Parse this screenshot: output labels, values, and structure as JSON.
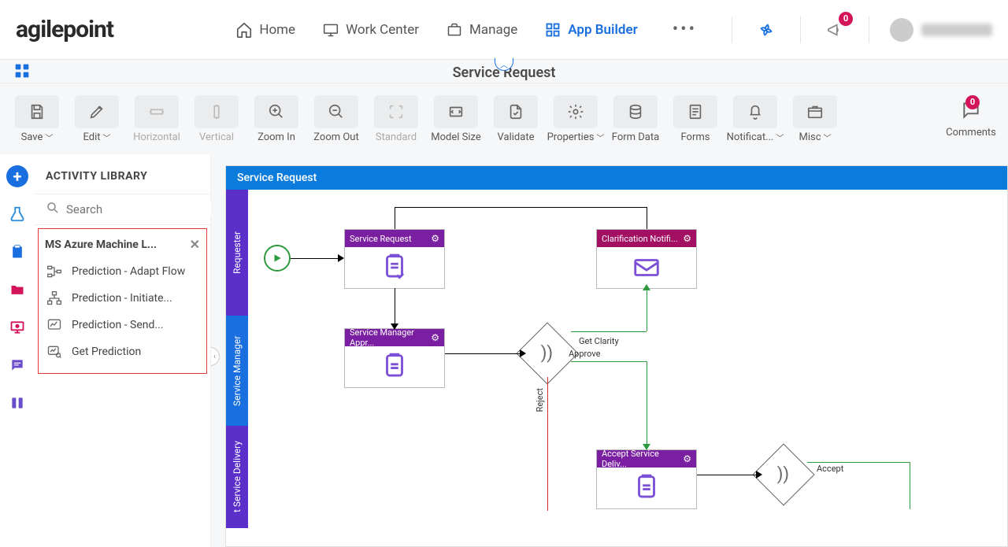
{
  "brand": "agilepoint",
  "nav": {
    "home": "Home",
    "workcenter": "Work Center",
    "manage": "Manage",
    "appbuilder": "App Builder"
  },
  "notify_badge": "0",
  "subheader": {
    "title": "Service Request"
  },
  "toolbar": {
    "save": "Save",
    "edit": "Edit",
    "horizontal": "Horizontal",
    "vertical": "Vertical",
    "zoomin": "Zoom In",
    "zoomout": "Zoom Out",
    "standard": "Standard",
    "modelsize": "Model Size",
    "validate": "Validate",
    "properties": "Properties",
    "formdata": "Form Data",
    "forms": "Forms",
    "notifications": "Notificat...",
    "misc": "Misc",
    "comments": "Comments",
    "comments_badge": "0"
  },
  "library": {
    "title": "ACTIVITY LIBRARY",
    "search_placeholder": "Search",
    "group_title": "MS Azure Machine L...",
    "items": [
      {
        "label": "Prediction - Adapt Flow"
      },
      {
        "label": "Prediction - Initiate..."
      },
      {
        "label": "Prediction - Send..."
      },
      {
        "label": "Get Prediction"
      }
    ]
  },
  "canvas": {
    "title": "Service Request",
    "lanes": {
      "l1": "Requester",
      "l2": "Service Manager",
      "l3": "t Service Delivery"
    },
    "nodes": {
      "service_request": "Service Request",
      "clarification": "Clarification Notifi...",
      "mgr_approval": "Service Manager Appr...",
      "accept_delivery": "Accept Service Deliv..."
    },
    "labels": {
      "get_clarity": "Get Clarity",
      "approve": "Approve",
      "reject": "Reject",
      "accept": "Accept"
    }
  }
}
